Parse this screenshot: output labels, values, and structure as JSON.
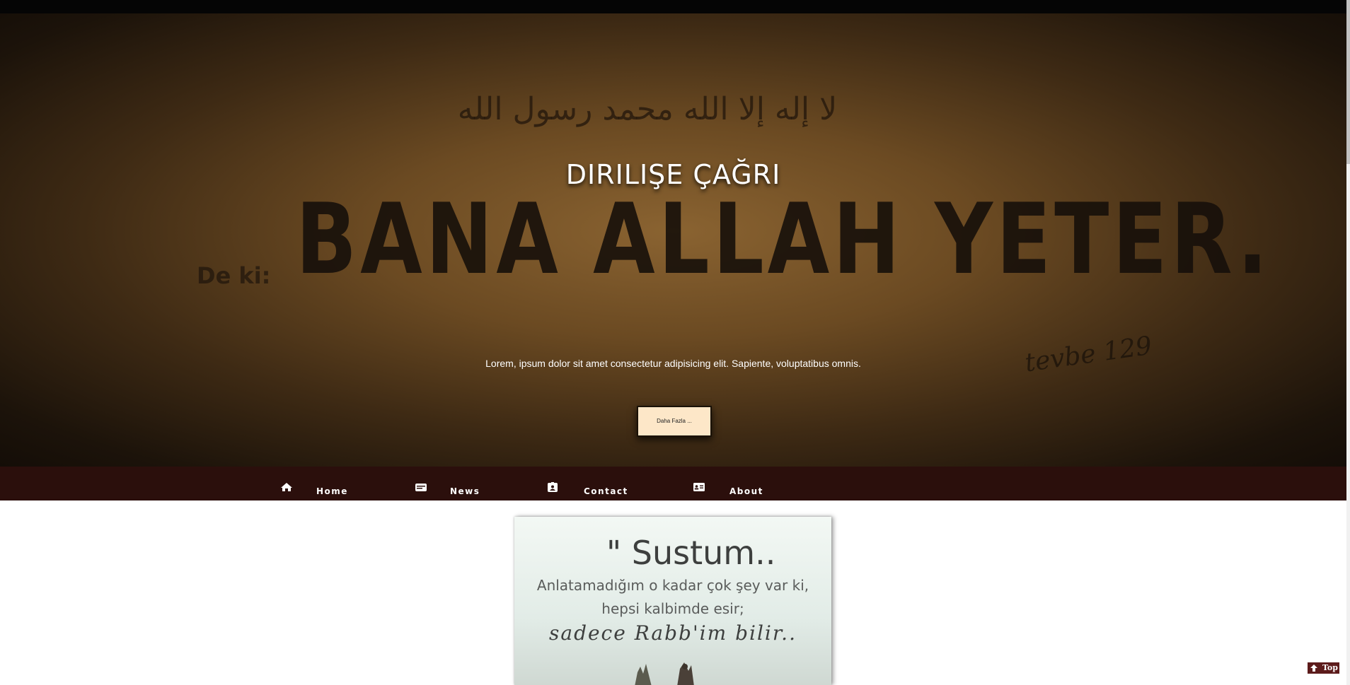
{
  "hero": {
    "background_arabic": "لا إله إلا الله محمد رسول الله",
    "background_prefix": "De ki:",
    "background_slogan": "BANA ALLAH YETER.",
    "background_signature": "tevbe 129",
    "title": "DIRILIŞE ÇAĞRI",
    "text": "Lorem, ipsum dolor sit amet consectetur adipisicing elit. Sapiente, voluptatibus omnis.",
    "button_label": "Daha Fazla ..."
  },
  "nav": {
    "items": [
      {
        "label": "Home",
        "icon": "home-icon"
      },
      {
        "label": "News",
        "icon": "news-icon"
      },
      {
        "label": "Contact",
        "icon": "contact-icon"
      },
      {
        "label": "About",
        "icon": "about-card-icon"
      }
    ]
  },
  "quote_card": {
    "line1": "\" Sustum..",
    "line2": "Anlatamadığım o kadar çok şey var ki,",
    "line3": "hepsi kalbimde esir;",
    "line4": "sadece Rabb'im bilir.."
  },
  "back_to_top": {
    "label": "Top",
    "icon": "arrow-up-icon"
  },
  "colors": {
    "top_bar": "#050505",
    "navbar": "#2b0f0c",
    "button_bg": "#fde7c8",
    "top_button": "#5c1b1b"
  }
}
